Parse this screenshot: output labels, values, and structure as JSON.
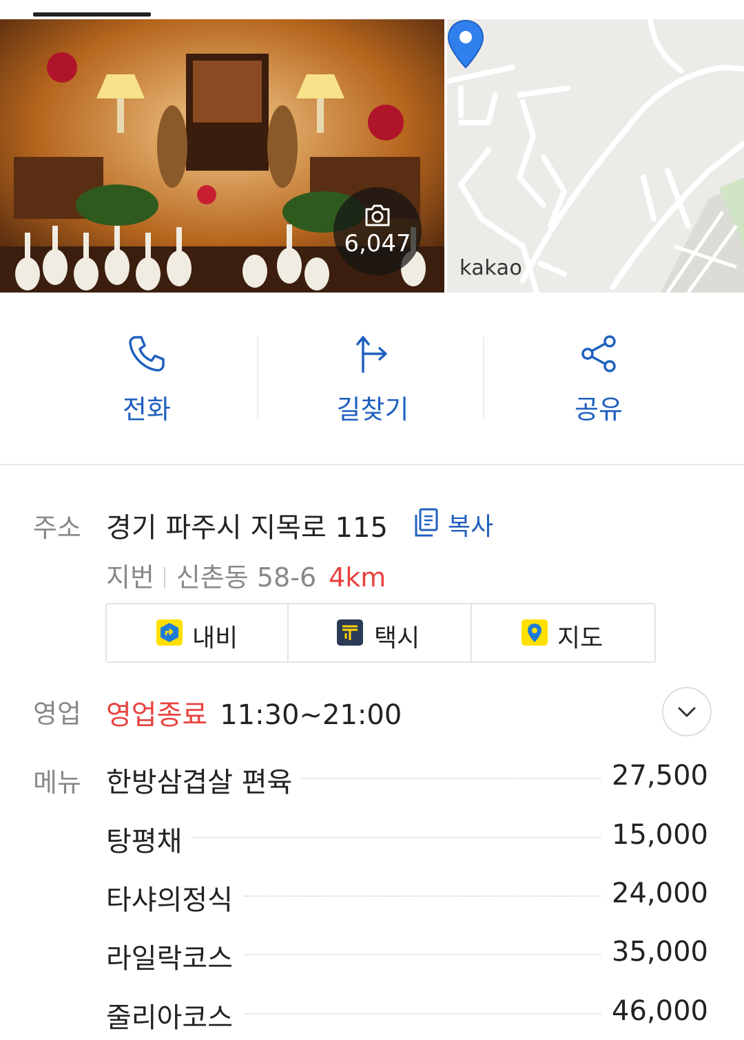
{
  "photo": {
    "count": "6,047"
  },
  "map": {
    "brand": "kakao"
  },
  "actions": [
    {
      "label": "전화",
      "icon": "phone-icon"
    },
    {
      "label": "길찾기",
      "icon": "directions-icon"
    },
    {
      "label": "공유",
      "icon": "share-icon"
    }
  ],
  "address": {
    "label": "주소",
    "main": "경기 파주시 지목로 115",
    "copy_label": "복사",
    "jibun_label": "지번",
    "jibun_value": "신촌동 58-6",
    "distance": "4km",
    "buttons": [
      {
        "label": "내비",
        "icon": "navi-icon"
      },
      {
        "label": "택시",
        "icon": "taxi-icon"
      },
      {
        "label": "지도",
        "icon": "map-pin-icon"
      }
    ]
  },
  "hours": {
    "label": "영업",
    "status": "영업종료",
    "time": "11:30~21:00"
  },
  "menu": {
    "label": "메뉴",
    "items": [
      {
        "name": "한방삼겹살 편육",
        "price": "27,500"
      },
      {
        "name": "탕평채",
        "price": "15,000"
      },
      {
        "name": "타샤의정식",
        "price": "24,000"
      },
      {
        "name": "라일락코스",
        "price": "35,000"
      },
      {
        "name": "줄리아코스",
        "price": "46,000"
      }
    ]
  },
  "colors": {
    "accent": "#1f5fbf",
    "status_red": "#e8423f",
    "pin_blue": "#2f80ed"
  }
}
